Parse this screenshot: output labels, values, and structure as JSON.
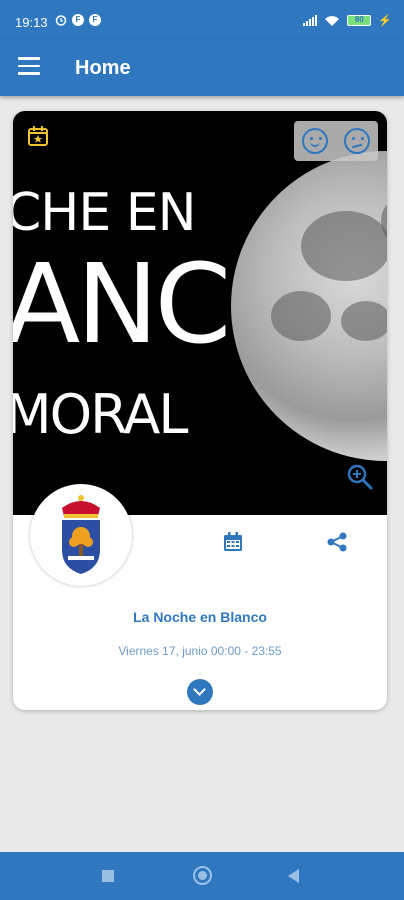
{
  "status_bar": {
    "time": "19:13",
    "notif_icons": [
      "alarm-icon",
      "f-icon",
      "f-icon"
    ],
    "battery_text": "80",
    "colors": {
      "background": "#2f78bf"
    }
  },
  "app_bar": {
    "title": "Home",
    "menu_icon": "hamburger-icon"
  },
  "card": {
    "hero_text": [
      "CHE EN",
      "ANC",
      "MORAL"
    ],
    "reaction_icons": [
      "smile-icon",
      "neutral-face-icon"
    ],
    "event_title": "La Noche en Blanco",
    "event_date": "Viernes 17, junio 00:00 - 23:55"
  },
  "colors": {
    "accent": "#2f78bf",
    "date_text": "#6e9cc9",
    "background": "#e9e9e9"
  }
}
